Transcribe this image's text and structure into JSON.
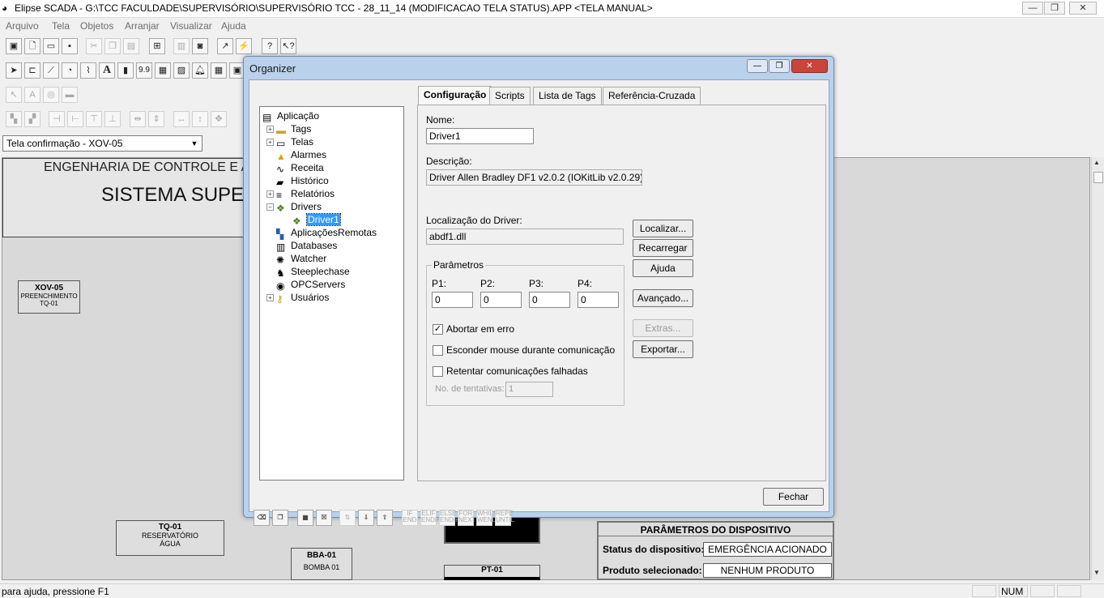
{
  "window": {
    "title": "Elipse SCADA - G:\\TCC FACULDADE\\SUPERVISÓRIO\\SUPERVISÓRIO TCC - 28_11_14 (MODIFICACAO TELA STATUS).APP <TELA MANUAL>",
    "controls": [
      "minimize-icon",
      "restore-icon",
      "close-icon"
    ]
  },
  "menu": [
    "Arquivo",
    "Tela",
    "Objetos",
    "Arranjar",
    "Visualizar",
    "Ajuda"
  ],
  "toolbar": {
    "text_tools": {
      "text": "A",
      "value": "9.9"
    }
  },
  "screen_combo": {
    "value": "Tela confirmação - XOV-05"
  },
  "canvas": {
    "header_line1": "ENGENHARIA DE CONTROLE E A",
    "header_line2": "SISTEMA SUPE",
    "xov": {
      "tag": "XOV-05",
      "line1": "PREENCHIMENTO",
      "line2": "TQ-01"
    },
    "tq": {
      "tag": "TQ-01",
      "line1": "RESERVATÓRIO",
      "line2": "ÁGUA"
    },
    "bba": {
      "tag": "BBA-01",
      "line1": "BOMBA 01"
    },
    "pt": {
      "tag": "PT-01"
    },
    "params": {
      "title": "PARÂMETROS DO DISPOSITIVO",
      "status_label": "Status do dispositivo:",
      "status_value": "EMERGÊNCIA ACIONADO",
      "product_label": "Produto selecionado:",
      "product_value": "NENHUM PRODUTO"
    }
  },
  "status_bar": {
    "help": "para ajuda, pressione F1",
    "num": "NUM"
  },
  "organizer": {
    "title": "Organizer",
    "tree": [
      {
        "label": "Aplicação",
        "icon": "app-icon"
      },
      {
        "label": "Tags",
        "icon": "folder-icon",
        "expand": "+"
      },
      {
        "label": "Telas",
        "icon": "screens-icon",
        "expand": "+"
      },
      {
        "label": "Alarmes",
        "icon": "alarm-bell-icon"
      },
      {
        "label": "Receita",
        "icon": "recipe-icon"
      },
      {
        "label": "Histórico",
        "icon": "history-icon"
      },
      {
        "label": "Relatórios",
        "icon": "report-icon",
        "expand": "+"
      },
      {
        "label": "Drivers",
        "icon": "driver-icon",
        "expand": "−"
      },
      {
        "label": "Driver1",
        "icon": "driver-icon",
        "selected": true
      },
      {
        "label": "AplicaçõesRemotas",
        "icon": "network-icon"
      },
      {
        "label": "Databases",
        "icon": "database-icon"
      },
      {
        "label": "Watcher",
        "icon": "watcher-icon"
      },
      {
        "label": "Steeplechase",
        "icon": "steeplechase-icon"
      },
      {
        "label": "OPCServers",
        "icon": "opc-icon"
      },
      {
        "label": "Usuários",
        "icon": "key-icon",
        "expand": "+"
      }
    ],
    "tabs": [
      "Configuração",
      "Scripts",
      "Lista de Tags",
      "Referência-Cruzada"
    ],
    "form": {
      "name_label": "Nome:",
      "name_value": "Driver1",
      "desc_label": "Descrição:",
      "desc_value": "Driver Allen Bradley DF1 v2.0.2 (IOKitLib v2.0.29)",
      "loc_label": "Localização do Driver:",
      "loc_value": "abdf1.dll",
      "params_group": "Parâmetros",
      "p_labels": [
        "P1:",
        "P2:",
        "P3:",
        "P4:"
      ],
      "p_values": [
        "0",
        "0",
        "0",
        "0"
      ],
      "chk_abort": "Abortar em erro",
      "chk_abort_checked": true,
      "chk_hide_mouse": "Esconder mouse durante comunicação",
      "chk_retry": "Retentar comunicações falhadas",
      "retries_label": "No. de tentativas:",
      "retries_value": "1"
    },
    "buttons": {
      "locate": "Localizar...",
      "reload": "Recarregar",
      "help": "Ajuda",
      "advanced": "Avançado...",
      "extras": "Extras...",
      "export": "Exportar...",
      "close": "Fechar"
    },
    "script_buttons": [
      {
        "l1": "IF",
        "l2": "END"
      },
      {
        "l1": "ELIF",
        "l2": "ENDIF"
      },
      {
        "l1": "ELSE",
        "l2": "ENDIF"
      },
      {
        "l1": "FOR",
        "l2": "NEXT"
      },
      {
        "l1": "WHILE",
        "l2": "WEND"
      },
      {
        "l1": "REPE",
        "l2": "UNTIL"
      }
    ]
  }
}
